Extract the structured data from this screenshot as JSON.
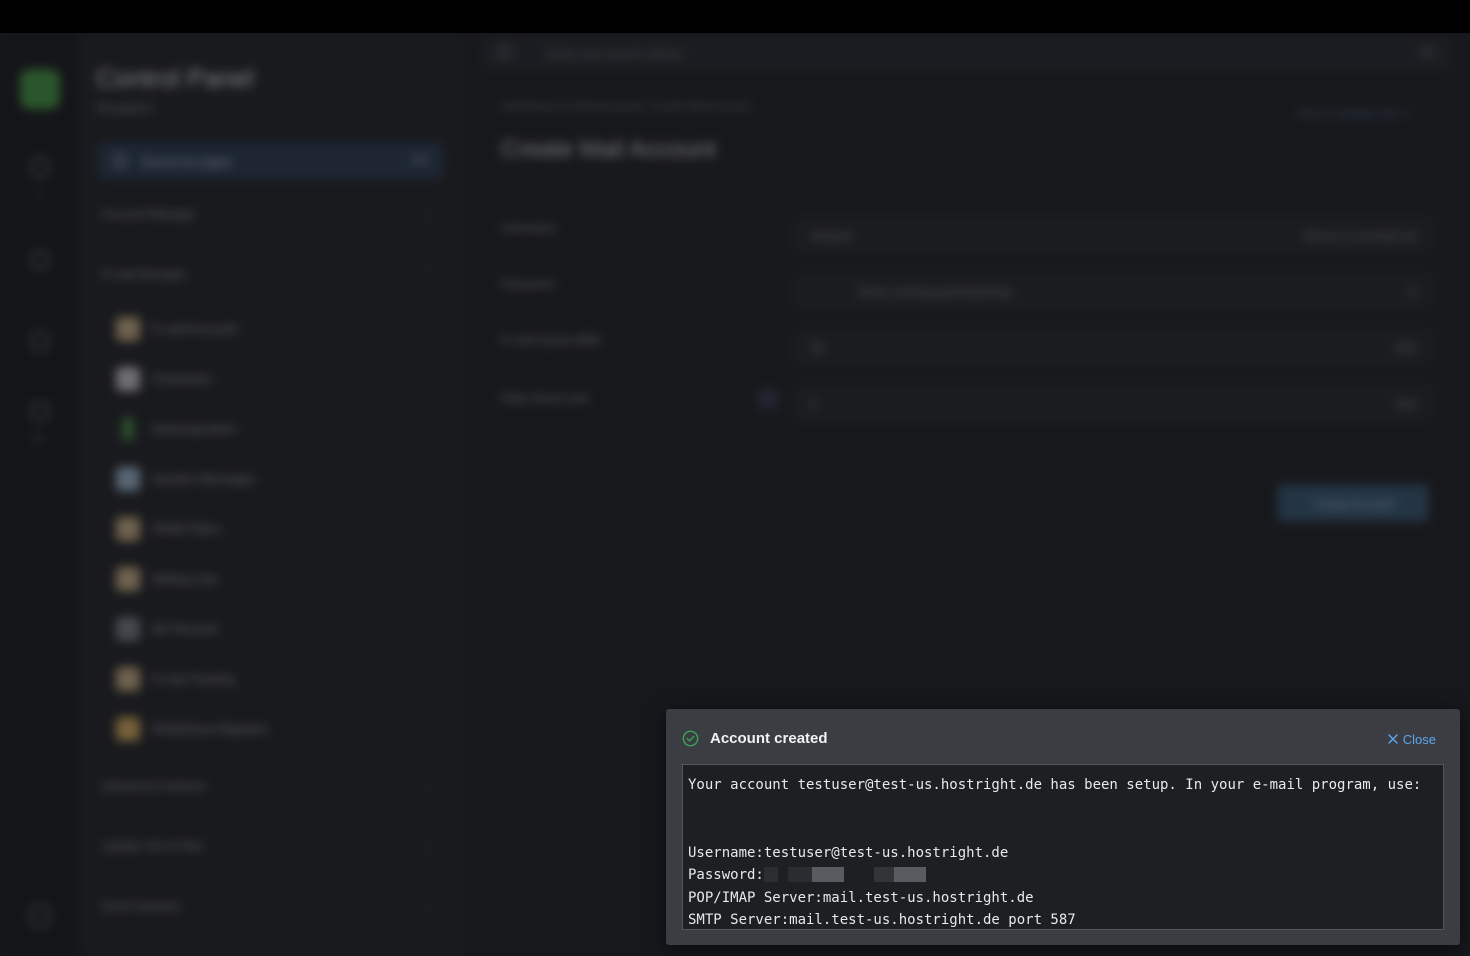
{
  "sidebar": {
    "title": "Control Panel",
    "subtitle": "Navigation",
    "search_label": "Search for pages",
    "search_shortcut": "⌘K",
    "sections": [
      {
        "label": "Account Manager",
        "chevron": "⌄"
      },
      {
        "label": "E-mail Manager",
        "chevron": "⌃"
      },
      {
        "label": "Advanced Features",
        "chevron": "⌄"
      },
      {
        "label": "Update Info & Files",
        "chevron": "⌄"
      },
      {
        "label": "Extra Features",
        "chevron": "⌄"
      }
    ],
    "email_items": [
      {
        "label": "E-mail Accounts"
      },
      {
        "label": "Forwarders"
      },
      {
        "label": "Autoresponders"
      },
      {
        "label": "Vacation Messages"
      },
      {
        "label": "SPAM Filters"
      },
      {
        "label": "Mailing Lists"
      },
      {
        "label": "MX Records"
      },
      {
        "label": "E-mail Tracking"
      },
      {
        "label": "DKIM/Sieve Migration"
      }
    ],
    "rail_captions": [
      "A",
      "Me"
    ]
  },
  "main": {
    "search_placeholder": "Enter your search criteria",
    "search_shortcut": "⌘K",
    "breadcrumb": "Dashboard / E-Mail Accounts / Create Mail Account",
    "help_link": "How to manage mail ↗",
    "title": "Create Mail Account",
    "fields": [
      {
        "label": "Username",
        "value": "testuser",
        "suffix": "@test-us.hostright.de"
      },
      {
        "label": "Password",
        "value": "Enter a strong generated key",
        "suffix": "⟳"
      },
      {
        "label": "E-mail Quota (MB)",
        "value": "50",
        "suffix": "MBs"
      },
      {
        "label": "Daily Send Limit",
        "value": "0",
        "suffix": "Max"
      }
    ],
    "create_button": "Create Account"
  },
  "dialog": {
    "title": "Account created",
    "close_label": "Close",
    "line_setup": "Your account testuser@test-us.hostright.de has been setup. In your e-mail program, use:",
    "line_username": "Username:testuser@test-us.hostright.de",
    "line_password_label": "Password:",
    "line_pop": "POP/IMAP Server:mail.test-us.hostright.de",
    "line_smtp": "SMTP Server:mail.test-us.hostright.de port 587"
  },
  "colors": {
    "success": "#3aa35a",
    "link": "#5aa8f0",
    "dialog_bg": "#3c3d42",
    "body_bg": "#1e1f23"
  },
  "icons": {
    "success": "check-circle-icon",
    "close": "close-x-icon"
  }
}
